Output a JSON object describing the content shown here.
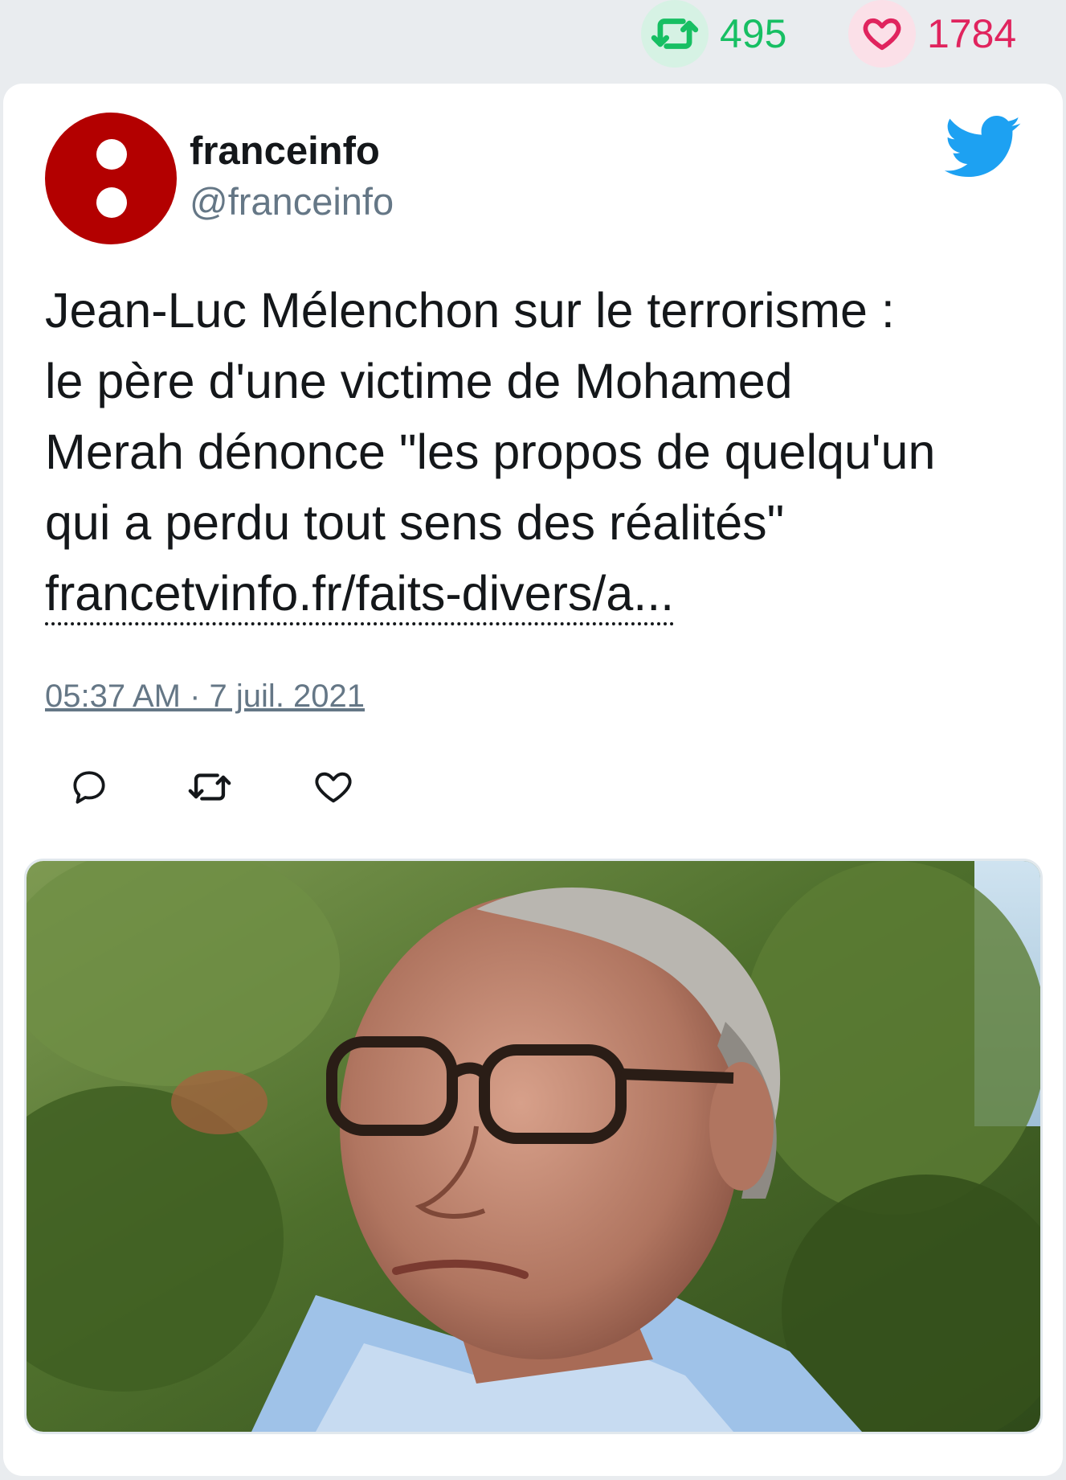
{
  "stats": {
    "retweets": "495",
    "likes": "1784",
    "retweet_icon": "retweet-icon",
    "like_icon": "heart-icon",
    "retweet_color": "#17bf63",
    "like_color": "#e0245e"
  },
  "tweet": {
    "author": {
      "name": "franceinfo",
      "handle": "@franceinfo",
      "avatar_color": "#b30000"
    },
    "text_lines": [
      "Jean-Luc Mélenchon sur le terrorisme :",
      "le père d'une victime de Mohamed",
      "Merah dénonce \"les propos de quelqu'un",
      "qui a perdu tout sens des réalités\""
    ],
    "link": "francetvinfo.fr/faits-divers/a...",
    "timestamp": "05:37 AM · 7 juil. 2021",
    "actions": [
      "reply-icon",
      "retweet-icon",
      "heart-icon"
    ],
    "brand_color": "#1da1f2",
    "media": {
      "description_icon": "photo-of-man-with-glasses"
    }
  }
}
